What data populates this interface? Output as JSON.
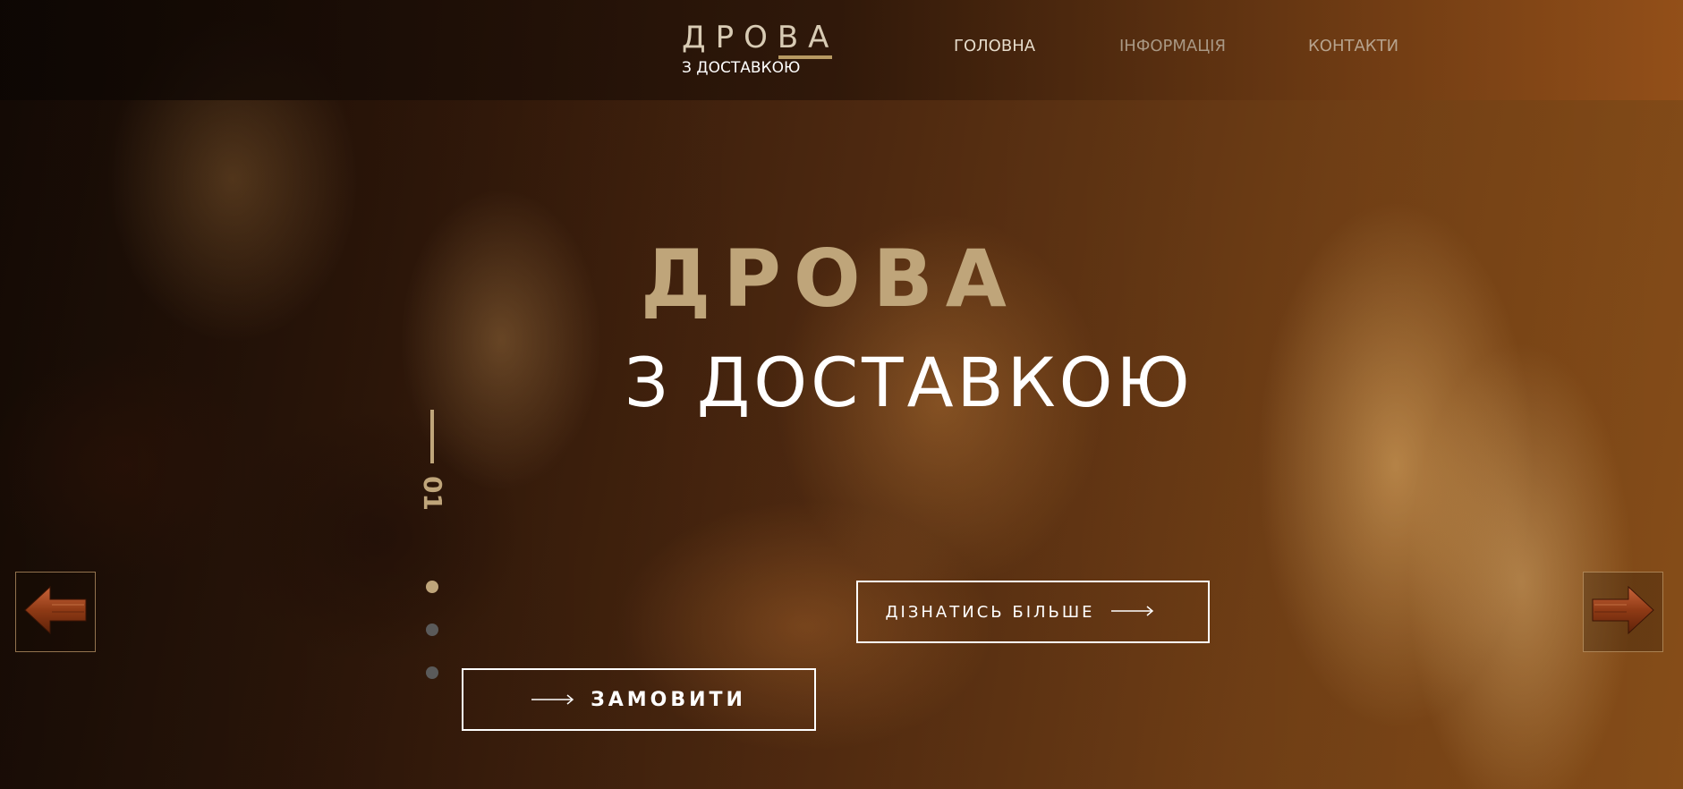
{
  "header": {
    "logo_main": "ДРОВА",
    "logo_sub": "З ДОСТАВКОЮ",
    "nav": [
      {
        "label": "ГОЛОВНА",
        "color": "#e6dccb"
      },
      {
        "label": "ІНФОРМАЦІЯ",
        "color": "#a99884"
      },
      {
        "label": "КОНТАКТИ",
        "color": "#b7a38d"
      }
    ]
  },
  "hero": {
    "title": "ДРОВА",
    "subtitle": "З ДОСТАВКОЮ",
    "slide_number": "01",
    "slides_total": 3,
    "active_slide": 1,
    "more_button": "ДІЗНАТИСЬ БІЛЬШЕ",
    "order_button": "ЗАМОВИТИ"
  },
  "icons": {
    "prev": "arrow-left-icon",
    "next": "arrow-right-icon",
    "button_arrow": "long-arrow-right-icon"
  },
  "colors": {
    "accent": "#bfa57a",
    "dot_active": "#bfa57a",
    "dot_inactive": "#5a5a5a",
    "wood_arrow": "#a8461c"
  }
}
